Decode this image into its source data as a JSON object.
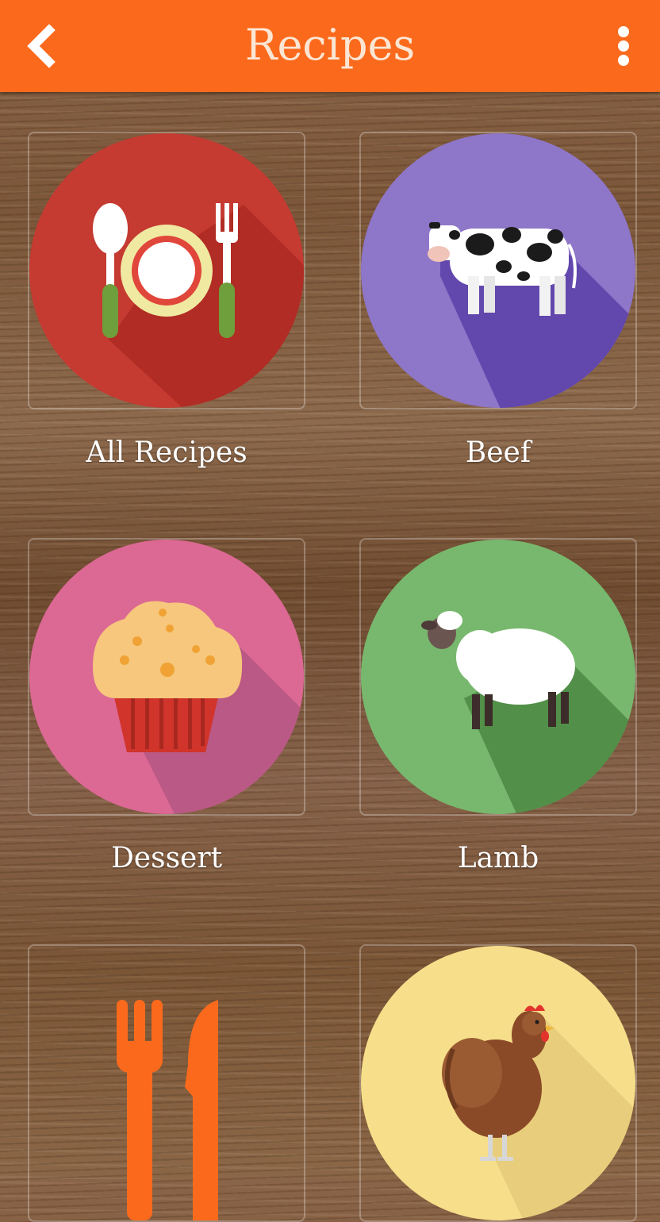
{
  "app_bar": {
    "title": "Recipes",
    "back_icon": "chevron-left-icon",
    "menu_icon": "more-vert-icon",
    "color": "#fb6a1c"
  },
  "categories": [
    {
      "label": "All Recipes",
      "icon": "plate-cutlery-icon",
      "color": "#c53a31"
    },
    {
      "label": "Beef",
      "icon": "cow-icon",
      "color": "#8e76c8"
    },
    {
      "label": "Dessert",
      "icon": "muffin-icon",
      "color": "#dc6894"
    },
    {
      "label": "Lamb",
      "icon": "sheep-icon",
      "color": "#78b86e"
    },
    {
      "label": "",
      "icon": "fork-knife-icon",
      "color": ""
    },
    {
      "label": "",
      "icon": "chicken-icon",
      "color": "#f7de8a"
    }
  ]
}
